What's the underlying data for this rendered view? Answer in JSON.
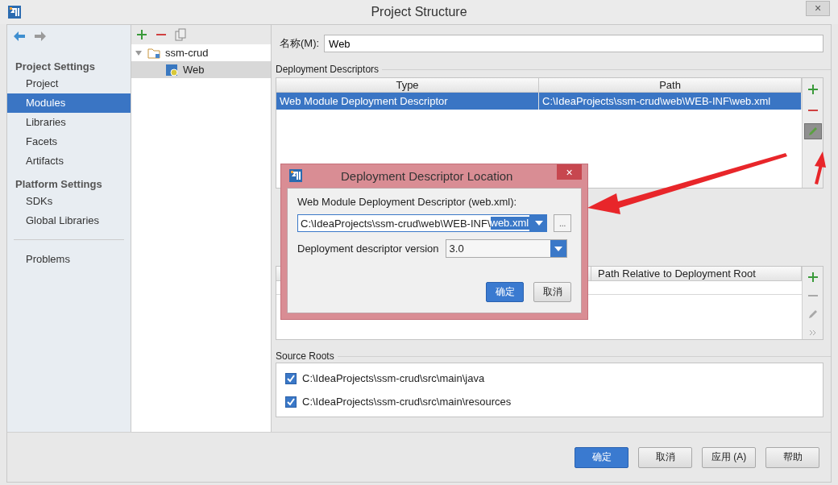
{
  "window": {
    "title": "Project Structure",
    "close": "×"
  },
  "sidebar": {
    "sections": [
      {
        "heading": "Project Settings",
        "items": [
          {
            "label": "Project",
            "selected": false
          },
          {
            "label": "Modules",
            "selected": true
          },
          {
            "label": "Libraries",
            "selected": false
          },
          {
            "label": "Facets",
            "selected": false
          },
          {
            "label": "Artifacts",
            "selected": false
          }
        ]
      },
      {
        "heading": "Platform Settings",
        "items": [
          {
            "label": "SDKs",
            "selected": false
          },
          {
            "label": "Global Libraries",
            "selected": false
          }
        ]
      }
    ],
    "footer_items": [
      {
        "label": "Problems",
        "selected": false
      }
    ]
  },
  "module_tree": {
    "nodes": [
      {
        "label": "ssm-crud",
        "kind": "folder",
        "expanded": true,
        "selected": false,
        "children": [
          {
            "label": "Web",
            "kind": "web",
            "selected": true
          }
        ]
      }
    ]
  },
  "name_field": {
    "label": "名称(M):",
    "value": "Web"
  },
  "deployment_descriptors": {
    "title": "Deployment Descriptors",
    "columns": [
      "Type",
      "Path"
    ],
    "rows": [
      {
        "cells": [
          "Web Module Deployment Descriptor",
          "C:\\IdeaProjects\\ssm-crud\\web\\WEB-INF\\web.xml"
        ],
        "selected": true
      }
    ],
    "tools": [
      {
        "kind": "add",
        "disabled": false,
        "pressed": false
      },
      {
        "kind": "remove",
        "disabled": false,
        "pressed": false
      },
      {
        "kind": "edit",
        "disabled": false,
        "pressed": true
      }
    ]
  },
  "web_resources": {
    "columns": [
      "Path Relative to Deployment Root"
    ],
    "tools": [
      {
        "kind": "add",
        "disabled": false,
        "pressed": false
      },
      {
        "kind": "remove",
        "disabled": true,
        "pressed": false
      },
      {
        "kind": "edit",
        "disabled": true,
        "pressed": false
      },
      {
        "kind": "more",
        "disabled": true,
        "pressed": false
      }
    ]
  },
  "source_roots": {
    "title": "Source Roots",
    "items": [
      {
        "path": "C:\\IdeaProjects\\ssm-crud\\src\\main\\java",
        "checked": true
      },
      {
        "path": "C:\\IdeaProjects\\ssm-crud\\src\\main\\resources",
        "checked": true
      }
    ]
  },
  "buttons": [
    {
      "label": "确定",
      "primary": true
    },
    {
      "label": "取消",
      "primary": false
    },
    {
      "label": "应用 (A)",
      "primary": false
    },
    {
      "label": "帮助",
      "primary": false
    }
  ],
  "dialog": {
    "title": "Deployment Descriptor Location",
    "close": "×",
    "field_label": "Web Module Deployment Descriptor (web.xml):",
    "path_value": "C:\\IdeaProjects\\ssm-crud\\web\\WEB-INF\\",
    "path_selection": "web.xml",
    "browse": "...",
    "version_label": "Deployment descriptor version",
    "version_value": "3.0",
    "buttons": [
      {
        "label": "确定",
        "primary": true
      },
      {
        "label": "取消",
        "primary": false
      }
    ]
  }
}
